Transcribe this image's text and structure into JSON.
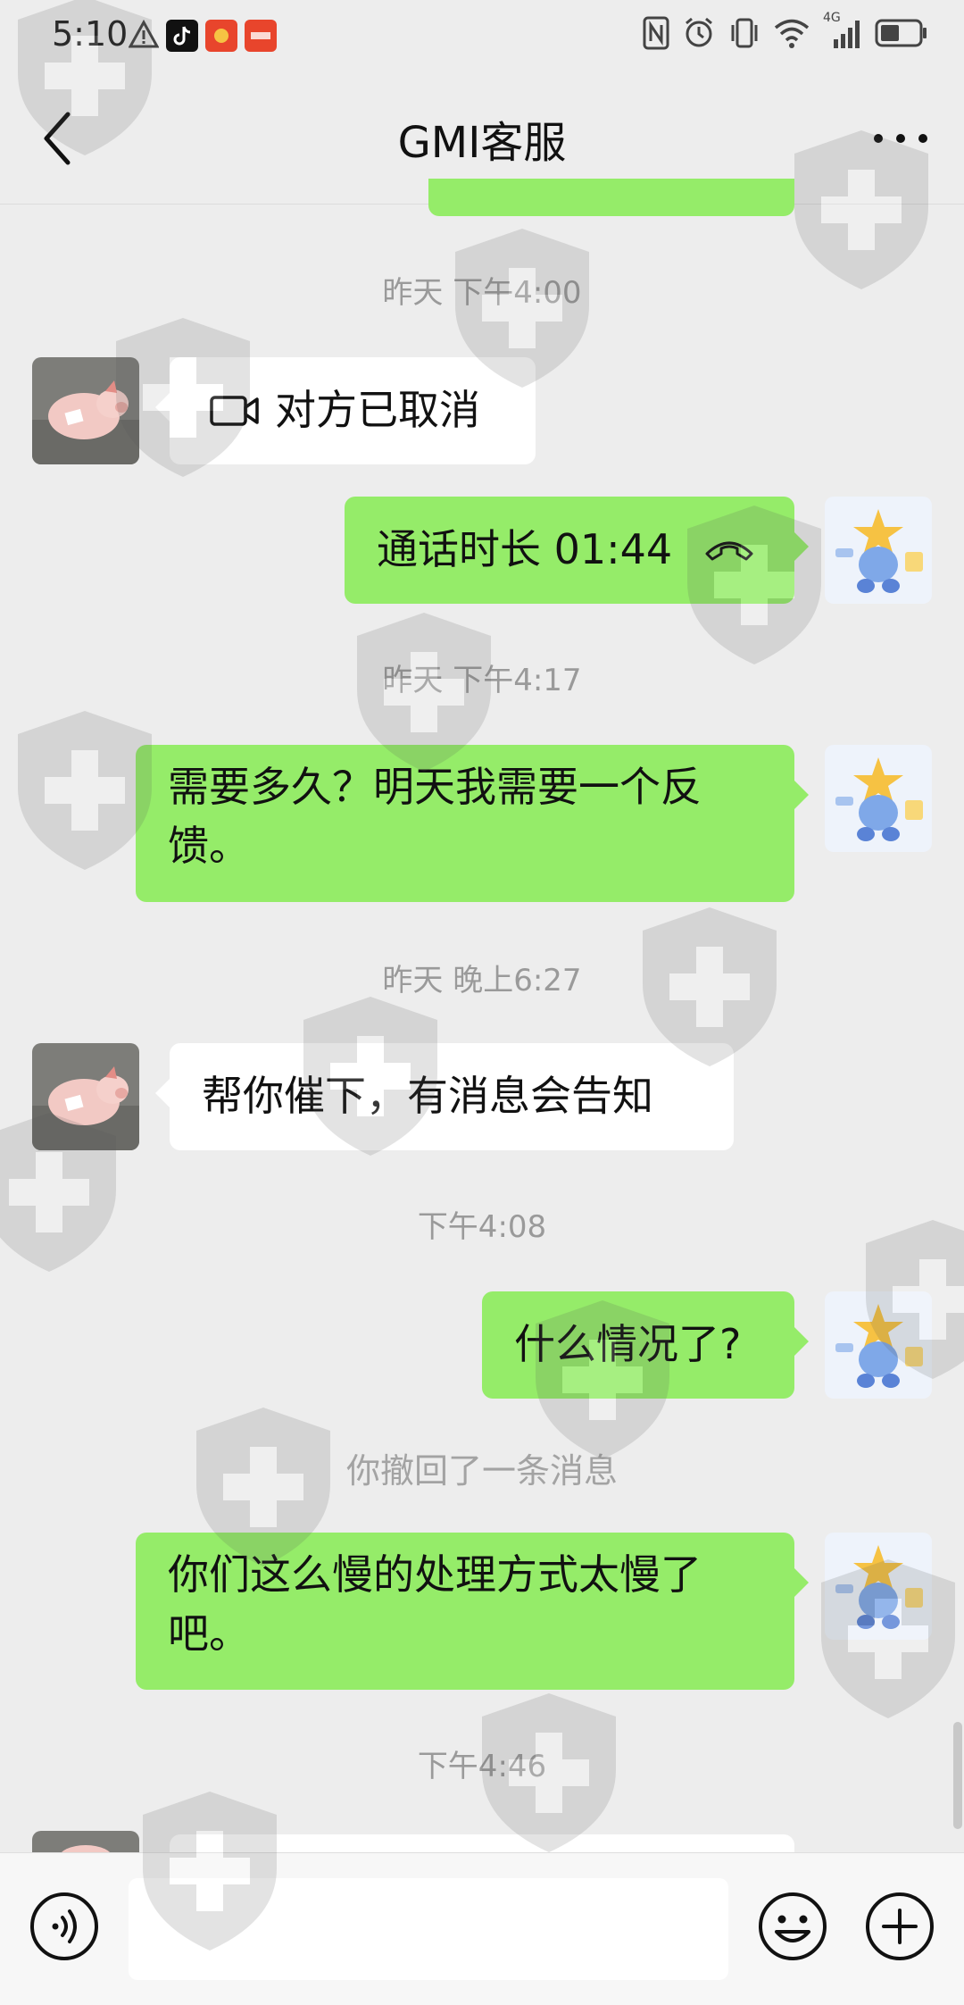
{
  "status_bar": {
    "time": "5:10",
    "network_label": "4G"
  },
  "header": {
    "title": "GMI客服"
  },
  "messages": {
    "ts1": "昨天 下午4:00",
    "video_call": "对方已取消",
    "call_duration": "通话时长 01:44",
    "ts2": "昨天 下午4:17",
    "msg_ask": "需要多久？明天我需要一个反馈。",
    "ts3": "昨天 晚上6:27",
    "msg_reply": "帮你催下，有消息会告知",
    "ts4": "下午4:08",
    "msg_status": "什么情况了?",
    "recall_notice": "你撤回了一条消息",
    "msg_slow": "你们这么慢的处理方式太慢了吧。",
    "ts5": "下午4:46"
  },
  "input_bar": {
    "placeholder": ""
  },
  "colors": {
    "background": "#ededed",
    "sent_bubble": "#95ec69",
    "received_bubble": "#ffffff",
    "timestamp": "#9a9a9a"
  },
  "icons": {
    "back": "chevron-left-icon",
    "more": "more-dots-icon",
    "video": "video-call-icon",
    "phone": "hangup-phone-icon",
    "voice": "voice-input-icon",
    "emoji": "emoji-icon",
    "plus": "plus-icon"
  }
}
